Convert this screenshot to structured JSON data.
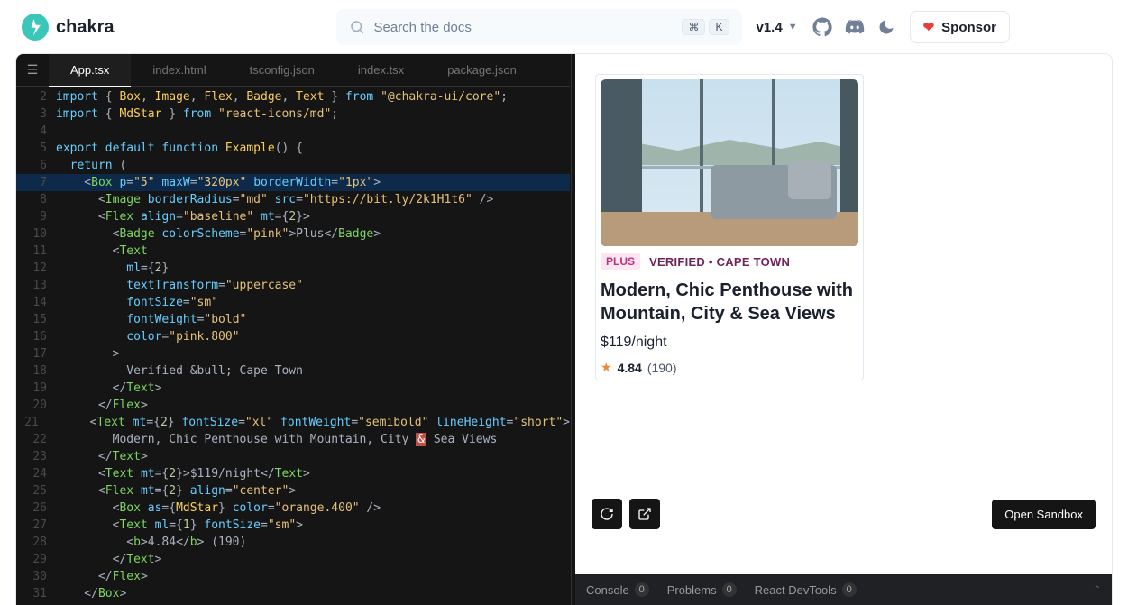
{
  "brand": "chakra",
  "search": {
    "placeholder": "Search the docs",
    "shortcut": [
      "⌘",
      "K"
    ]
  },
  "version": "v1.4",
  "sponsor_label": "Sponsor",
  "editor": {
    "tabs": [
      "App.tsx",
      "index.html",
      "tsconfig.json",
      "index.tsx",
      "package.json"
    ],
    "active_tab": "App.tsx"
  },
  "code": {
    "lines": [
      {
        "n": 2,
        "tokens": [
          [
            "kw",
            "import"
          ],
          [
            "punc",
            " { "
          ],
          [
            "ident",
            "Box"
          ],
          [
            "punc",
            ", "
          ],
          [
            "ident",
            "Image"
          ],
          [
            "punc",
            ", "
          ],
          [
            "ident",
            "Flex"
          ],
          [
            "punc",
            ", "
          ],
          [
            "ident",
            "Badge"
          ],
          [
            "punc",
            ", "
          ],
          [
            "ident",
            "Text"
          ],
          [
            "punc",
            " } "
          ],
          [
            "kw",
            "from"
          ],
          [
            "punc",
            " "
          ],
          [
            "str",
            "\"@chakra-ui/core\""
          ],
          [
            "punc",
            ";"
          ]
        ]
      },
      {
        "n": 3,
        "tokens": [
          [
            "kw",
            "import"
          ],
          [
            "punc",
            " { "
          ],
          [
            "ident",
            "MdStar"
          ],
          [
            "punc",
            " } "
          ],
          [
            "kw",
            "from"
          ],
          [
            "punc",
            " "
          ],
          [
            "str",
            "\"react-icons/md\""
          ],
          [
            "punc",
            ";"
          ]
        ]
      },
      {
        "n": 4,
        "tokens": []
      },
      {
        "n": 5,
        "tokens": [
          [
            "kw",
            "export"
          ],
          [
            "punc",
            " "
          ],
          [
            "kw",
            "default"
          ],
          [
            "punc",
            " "
          ],
          [
            "kw",
            "function"
          ],
          [
            "punc",
            " "
          ],
          [
            "fn",
            "Example"
          ],
          [
            "punc",
            "() {"
          ]
        ]
      },
      {
        "n": 6,
        "tokens": [
          [
            "punc",
            "  "
          ],
          [
            "kw",
            "return"
          ],
          [
            "punc",
            " ("
          ]
        ]
      },
      {
        "n": 7,
        "hl": true,
        "tokens": [
          [
            "punc",
            "    <"
          ],
          [
            "tag",
            "Box"
          ],
          [
            "punc",
            " "
          ],
          [
            "attr",
            "p"
          ],
          [
            "punc",
            "="
          ],
          [
            "str",
            "\"5\""
          ],
          [
            "punc",
            " "
          ],
          [
            "attr",
            "maxW"
          ],
          [
            "punc",
            "="
          ],
          [
            "str",
            "\"320px\""
          ],
          [
            "punc",
            " "
          ],
          [
            "attr",
            "borderWidth"
          ],
          [
            "punc",
            "="
          ],
          [
            "str",
            "\"1px\""
          ],
          [
            "punc",
            ">"
          ]
        ]
      },
      {
        "n": 8,
        "tokens": [
          [
            "punc",
            "      <"
          ],
          [
            "tag",
            "Image"
          ],
          [
            "punc",
            " "
          ],
          [
            "attr",
            "borderRadius"
          ],
          [
            "punc",
            "="
          ],
          [
            "str",
            "\"md\""
          ],
          [
            "punc",
            " "
          ],
          [
            "attr",
            "src"
          ],
          [
            "punc",
            "="
          ],
          [
            "str",
            "\"https://bit.ly/2k1H1t6\""
          ],
          [
            "punc",
            " />"
          ]
        ]
      },
      {
        "n": 9,
        "tokens": [
          [
            "punc",
            "      <"
          ],
          [
            "tag",
            "Flex"
          ],
          [
            "punc",
            " "
          ],
          [
            "attr",
            "align"
          ],
          [
            "punc",
            "="
          ],
          [
            "str",
            "\"baseline\""
          ],
          [
            "punc",
            " "
          ],
          [
            "attr",
            "mt"
          ],
          [
            "punc",
            "={"
          ],
          [
            "num",
            "2"
          ],
          [
            "punc",
            "}>"
          ]
        ]
      },
      {
        "n": 10,
        "tokens": [
          [
            "punc",
            "        <"
          ],
          [
            "tag",
            "Badge"
          ],
          [
            "punc",
            " "
          ],
          [
            "attr",
            "colorScheme"
          ],
          [
            "punc",
            "="
          ],
          [
            "str",
            "\"pink\""
          ],
          [
            "punc",
            ">"
          ],
          [
            "val",
            "Plus"
          ],
          [
            "punc",
            "</"
          ],
          [
            "tag",
            "Badge"
          ],
          [
            "punc",
            ">"
          ]
        ]
      },
      {
        "n": 11,
        "tokens": [
          [
            "punc",
            "        <"
          ],
          [
            "tag",
            "Text"
          ]
        ]
      },
      {
        "n": 12,
        "tokens": [
          [
            "punc",
            "          "
          ],
          [
            "attr",
            "ml"
          ],
          [
            "punc",
            "={"
          ],
          [
            "num",
            "2"
          ],
          [
            "punc",
            "}"
          ]
        ]
      },
      {
        "n": 13,
        "tokens": [
          [
            "punc",
            "          "
          ],
          [
            "attr",
            "textTransform"
          ],
          [
            "punc",
            "="
          ],
          [
            "str",
            "\"uppercase\""
          ]
        ]
      },
      {
        "n": 14,
        "tokens": [
          [
            "punc",
            "          "
          ],
          [
            "attr",
            "fontSize"
          ],
          [
            "punc",
            "="
          ],
          [
            "str",
            "\"sm\""
          ]
        ]
      },
      {
        "n": 15,
        "tokens": [
          [
            "punc",
            "          "
          ],
          [
            "attr",
            "fontWeight"
          ],
          [
            "punc",
            "="
          ],
          [
            "str",
            "\"bold\""
          ]
        ]
      },
      {
        "n": 16,
        "tokens": [
          [
            "punc",
            "          "
          ],
          [
            "attr",
            "color"
          ],
          [
            "punc",
            "="
          ],
          [
            "str",
            "\"pink.800\""
          ]
        ]
      },
      {
        "n": 17,
        "tokens": [
          [
            "punc",
            "        >"
          ]
        ]
      },
      {
        "n": 18,
        "tokens": [
          [
            "punc",
            "          "
          ],
          [
            "val",
            "Verified &bull; Cape Town"
          ]
        ]
      },
      {
        "n": 19,
        "tokens": [
          [
            "punc",
            "        </"
          ],
          [
            "tag",
            "Text"
          ],
          [
            "punc",
            ">"
          ]
        ]
      },
      {
        "n": 20,
        "tokens": [
          [
            "punc",
            "      </"
          ],
          [
            "tag",
            "Flex"
          ],
          [
            "punc",
            ">"
          ]
        ]
      },
      {
        "n": 21,
        "tokens": [
          [
            "punc",
            "      <"
          ],
          [
            "tag",
            "Text"
          ],
          [
            "punc",
            " "
          ],
          [
            "attr",
            "mt"
          ],
          [
            "punc",
            "={"
          ],
          [
            "num",
            "2"
          ],
          [
            "punc",
            "} "
          ],
          [
            "attr",
            "fontSize"
          ],
          [
            "punc",
            "="
          ],
          [
            "str",
            "\"xl\""
          ],
          [
            "punc",
            " "
          ],
          [
            "attr",
            "fontWeight"
          ],
          [
            "punc",
            "="
          ],
          [
            "str",
            "\"semibold\""
          ],
          [
            "punc",
            " "
          ],
          [
            "attr",
            "lineHeight"
          ],
          [
            "punc",
            "="
          ],
          [
            "str",
            "\"short\""
          ],
          [
            "punc",
            ">"
          ]
        ]
      },
      {
        "n": 22,
        "tokens": [
          [
            "punc",
            "        "
          ],
          [
            "val",
            "Modern, Chic Penthouse with Mountain, City "
          ],
          [
            "warn",
            "&"
          ],
          [
            "val",
            " Sea Views"
          ]
        ]
      },
      {
        "n": 23,
        "tokens": [
          [
            "punc",
            "      </"
          ],
          [
            "tag",
            "Text"
          ],
          [
            "punc",
            ">"
          ]
        ]
      },
      {
        "n": 24,
        "tokens": [
          [
            "punc",
            "      <"
          ],
          [
            "tag",
            "Text"
          ],
          [
            "punc",
            " "
          ],
          [
            "attr",
            "mt"
          ],
          [
            "punc",
            "={"
          ],
          [
            "num",
            "2"
          ],
          [
            "punc",
            "}>"
          ],
          [
            "val",
            "$119/night"
          ],
          [
            "punc",
            "</"
          ],
          [
            "tag",
            "Text"
          ],
          [
            "punc",
            ">"
          ]
        ]
      },
      {
        "n": 25,
        "tokens": [
          [
            "punc",
            "      <"
          ],
          [
            "tag",
            "Flex"
          ],
          [
            "punc",
            " "
          ],
          [
            "attr",
            "mt"
          ],
          [
            "punc",
            "={"
          ],
          [
            "num",
            "2"
          ],
          [
            "punc",
            "} "
          ],
          [
            "attr",
            "align"
          ],
          [
            "punc",
            "="
          ],
          [
            "str",
            "\"center\""
          ],
          [
            "punc",
            ">"
          ]
        ]
      },
      {
        "n": 26,
        "tokens": [
          [
            "punc",
            "        <"
          ],
          [
            "tag",
            "Box"
          ],
          [
            "punc",
            " "
          ],
          [
            "attr",
            "as"
          ],
          [
            "punc",
            "={"
          ],
          [
            "ident",
            "MdStar"
          ],
          [
            "punc",
            "} "
          ],
          [
            "attr",
            "color"
          ],
          [
            "punc",
            "="
          ],
          [
            "str",
            "\"orange.400\""
          ],
          [
            "punc",
            " />"
          ]
        ]
      },
      {
        "n": 27,
        "tokens": [
          [
            "punc",
            "        <"
          ],
          [
            "tag",
            "Text"
          ],
          [
            "punc",
            " "
          ],
          [
            "attr",
            "ml"
          ],
          [
            "punc",
            "={"
          ],
          [
            "num",
            "1"
          ],
          [
            "punc",
            "} "
          ],
          [
            "attr",
            "fontSize"
          ],
          [
            "punc",
            "="
          ],
          [
            "str",
            "\"sm\""
          ],
          [
            "punc",
            ">"
          ]
        ]
      },
      {
        "n": 28,
        "tokens": [
          [
            "punc",
            "          <"
          ],
          [
            "tag",
            "b"
          ],
          [
            "punc",
            ">"
          ],
          [
            "val",
            "4.84"
          ],
          [
            "punc",
            "</"
          ],
          [
            "tag",
            "b"
          ],
          [
            "punc",
            "> "
          ],
          [
            "val",
            "(190)"
          ]
        ]
      },
      {
        "n": 29,
        "tokens": [
          [
            "punc",
            "        </"
          ],
          [
            "tag",
            "Text"
          ],
          [
            "punc",
            ">"
          ]
        ]
      },
      {
        "n": 30,
        "tokens": [
          [
            "punc",
            "      </"
          ],
          [
            "tag",
            "Flex"
          ],
          [
            "punc",
            ">"
          ]
        ]
      },
      {
        "n": 31,
        "tokens": [
          [
            "punc",
            "    </"
          ],
          [
            "tag",
            "Box"
          ],
          [
            "punc",
            ">"
          ]
        ]
      }
    ]
  },
  "preview": {
    "badge": "Plus",
    "meta": "Verified • Cape Town",
    "title": "Modern, Chic Penthouse with Mountain, City & Sea Views",
    "price": "$119/night",
    "rating": "4.84",
    "reviews": "(190)",
    "open_sandbox": "Open Sandbox"
  },
  "console": {
    "items": [
      "Console",
      "Problems",
      "React DevTools"
    ],
    "counts": [
      "0",
      "0",
      "0"
    ]
  }
}
